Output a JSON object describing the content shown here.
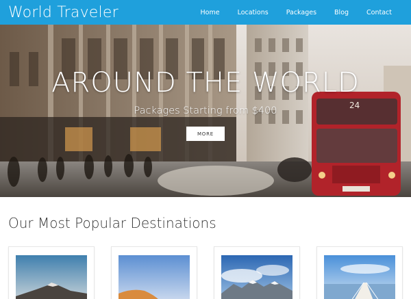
{
  "brand": "World Traveler",
  "nav": {
    "items": [
      "Home",
      "Locations",
      "Packages",
      "Blog",
      "Contact"
    ]
  },
  "hero": {
    "title": "AROUND THE WORLD",
    "subtitle": "Packages Starting from $400",
    "button_label": "MORE",
    "bus_route": "24"
  },
  "section": {
    "title": "Our Most Popular Destinations"
  },
  "cards": [
    {
      "image": "mountain-volcano"
    },
    {
      "image": "desert-dune"
    },
    {
      "image": "snowy-mountains"
    },
    {
      "image": "pier-ocean"
    }
  ],
  "colors": {
    "navbar": "#1fa0dc",
    "white": "#ffffff",
    "heading": "#333333"
  }
}
